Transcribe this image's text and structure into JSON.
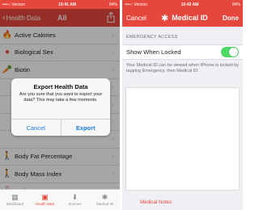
{
  "left": {
    "status": {
      "carrier": "••••○ Verizon",
      "time": "10:41 AM",
      "battery": "84%"
    },
    "nav": {
      "back_label": "Health Data",
      "title": "All"
    },
    "rows": [
      {
        "label": "Active Calories",
        "icon": "flame-icon",
        "glyph": "🔥"
      },
      {
        "label": "Biological Sex",
        "icon": "person-icon",
        "glyph": "●"
      },
      {
        "label": "Biotin",
        "icon": "carrot-icon",
        "glyph": "🥕"
      },
      {
        "label": "",
        "icon": "",
        "glyph": ""
      },
      {
        "label": "",
        "icon": "",
        "glyph": ""
      },
      {
        "label": "",
        "icon": "",
        "glyph": ""
      },
      {
        "label": "",
        "icon": "",
        "glyph": ""
      },
      {
        "label": "Body Fat Percentage",
        "icon": "figure-icon",
        "glyph": "🚶"
      },
      {
        "label": "Body Mass Index",
        "icon": "figure-icon",
        "glyph": "🚶"
      },
      {
        "label": "Body Temperature",
        "icon": "thermometer-icon",
        "glyph": "🌡"
      }
    ],
    "alert": {
      "title": "Export Health Data",
      "message": "Are you sure that you want to export your data? This may take a few moments.",
      "cancel": "Cancel",
      "confirm": "Export"
    },
    "tabs": [
      {
        "label": "Dashboard",
        "glyph": "▦"
      },
      {
        "label": "Health Data",
        "glyph": "▣"
      },
      {
        "label": "Sources",
        "glyph": "⬇"
      },
      {
        "label": "Medical ID",
        "glyph": "✱"
      }
    ]
  },
  "right": {
    "status": {
      "carrier": "••••○ Verizon",
      "time": "10:42 AM",
      "battery": "84%"
    },
    "nav": {
      "cancel": "Cancel",
      "title": "Medical ID",
      "done": "Done"
    },
    "section_header": "EMERGENCY ACCESS",
    "toggle_label": "Show When Locked",
    "toggle_on": true,
    "footer_note": "Your Medical ID can be viewed when iPhone is locked by tapping Emergency, then Medical ID.",
    "notes_label": "Medical Notes"
  },
  "colors": {
    "accent": "#e6473d",
    "link": "#1a7ae0",
    "switch_on": "#4cd964"
  }
}
